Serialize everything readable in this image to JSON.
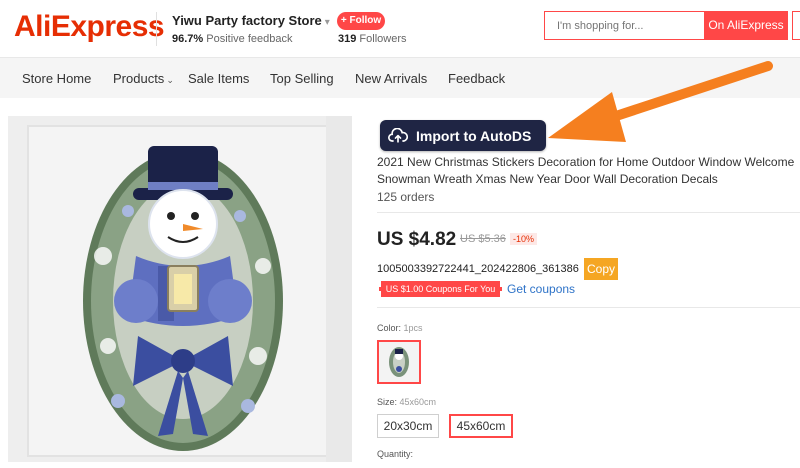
{
  "header": {
    "logo": "AliExpress",
    "store_name": "Yiwu Party factory Store",
    "feedback_value": "96.7%",
    "feedback_label": "Positive feedback",
    "follow_label": "+ Follow",
    "followers_count": "319",
    "followers_label": "Followers",
    "search_placeholder": "I'm shopping for...",
    "search_button": "On AliExpress"
  },
  "nav": {
    "items": [
      "Store Home",
      "Products",
      "Sale Items",
      "Top Selling",
      "New Arrivals",
      "Feedback"
    ]
  },
  "autods": {
    "button_label": "Import to AutoDS",
    "icon": "cloud-upload-icon"
  },
  "product": {
    "title": "2021 New Christmas Stickers Decoration for Home Outdoor Window Welcome Snowman Wreath Xmas New Year Door Wall Decoration Decals",
    "orders": "125 orders",
    "price": "US $4.82",
    "old_price": "US $5.36",
    "discount": "-10%",
    "sku": "1005003392722441_202422806_361386",
    "copy_label": "Copy",
    "coupon_label": "US $1.00 Coupons For You",
    "get_coupons": "Get coupons",
    "color_label": "Color:",
    "color_value": "1pcs",
    "size_label": "Size:",
    "size_value": "45x60cm",
    "sizes": [
      "20x30cm",
      "45x60cm"
    ],
    "quantity_label": "Quantity:"
  },
  "colors": {
    "brand_red": "#e62e04",
    "accent_red": "#ff4747",
    "autods_navy": "#1f2544",
    "arrow_orange": "#f57f1f",
    "copy_orange": "#f5a623",
    "link_blue": "#2e73c8"
  }
}
